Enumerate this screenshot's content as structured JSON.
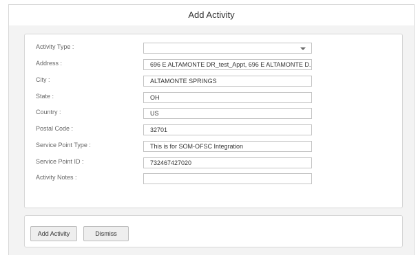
{
  "dialog": {
    "title": "Add Activity"
  },
  "form": {
    "activity_type": {
      "label": "Activity Type :",
      "value": ""
    },
    "address": {
      "label": "Address :",
      "value": "696 E ALTAMONTE DR_test_Appt, 696 E ALTAMONTE D..."
    },
    "city": {
      "label": "City :",
      "value": "ALTAMONTE SPRINGS"
    },
    "state": {
      "label": "State :",
      "value": "OH"
    },
    "country": {
      "label": "Country :",
      "value": "US"
    },
    "postal_code": {
      "label": "Postal Code :",
      "value": "32701"
    },
    "service_point_type": {
      "label": "Service Point Type :",
      "value": "This is for SOM-OFSC Integration"
    },
    "service_point_id": {
      "label": "Service Point ID :",
      "value": "732467427020"
    },
    "activity_notes": {
      "label": "Activity Notes :",
      "value": ""
    }
  },
  "footer": {
    "add_label": "Add Activity",
    "dismiss_label": "Dismiss"
  },
  "icons": {
    "dropdown": "chevron-down-icon"
  }
}
